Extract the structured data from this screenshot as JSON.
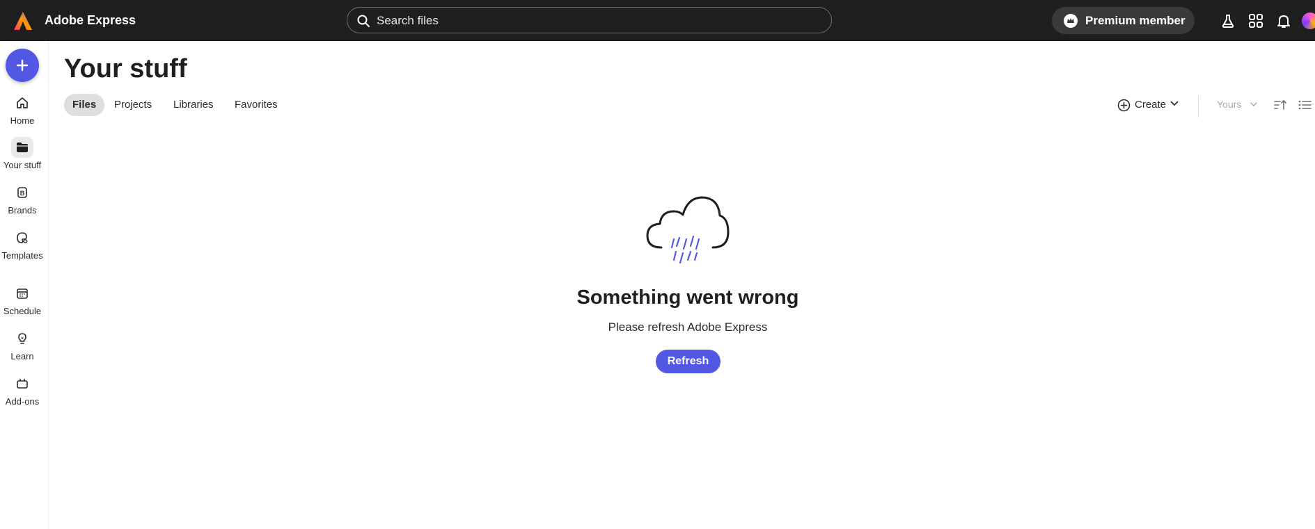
{
  "app": {
    "name": "Adobe Express"
  },
  "search": {
    "placeholder": "Search files"
  },
  "header": {
    "premium_label": "Premium member"
  },
  "rail": {
    "items": [
      {
        "label": "Home",
        "icon": "home-icon"
      },
      {
        "label": "Your stuff",
        "icon": "folder-icon"
      },
      {
        "label": "Brands",
        "icon": "brand-icon"
      },
      {
        "label": "Templates",
        "icon": "templates-icon"
      },
      {
        "label": "Schedule",
        "icon": "calendar-icon"
      },
      {
        "label": "Learn",
        "icon": "lightbulb-icon"
      },
      {
        "label": "Add-ons",
        "icon": "addons-icon"
      }
    ]
  },
  "page": {
    "title": "Your stuff",
    "tabs": [
      "Files",
      "Projects",
      "Libraries",
      "Favorites"
    ],
    "create_label": "Create",
    "owner_filter": "Yours"
  },
  "error": {
    "title": "Something went wrong",
    "message": "Please refresh Adobe Express",
    "button": "Refresh"
  },
  "colors": {
    "accent": "#5258e4",
    "topbar": "#1f1f1f",
    "premium_bg": "#3a3a3a"
  }
}
